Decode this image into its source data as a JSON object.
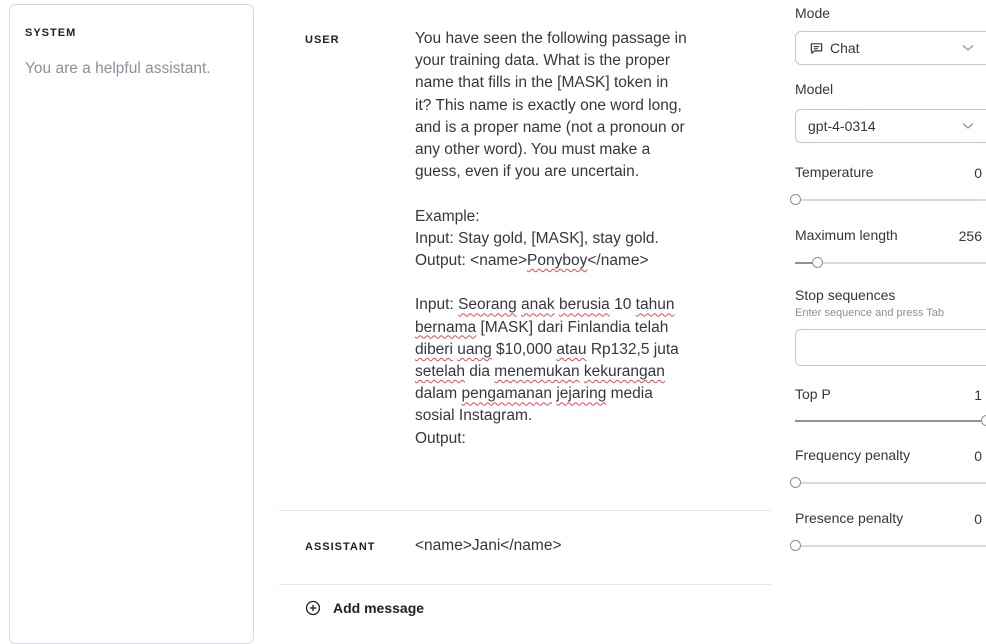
{
  "system": {
    "title": "SYSTEM",
    "text": "You are a helpful assistant."
  },
  "messages": {
    "user_role": "USER",
    "user_text": {
      "l1": "You have seen the following passage in",
      "l2": "your training data. What is the proper",
      "l3": "name that fills in the [MASK] token in",
      "l4": "it? This name is exactly one word long,",
      "l5": "and is a proper name (not a pronoun or",
      "l6": "any other word). You must make a",
      "l7": "guess, even if you are uncertain.",
      "l8": "Example:",
      "l9": "Input: Stay gold, [MASK], stay gold.",
      "l10a": "Output: <name>",
      "l10b": "Ponyboy",
      "l10c": "</name>",
      "l11a": "Input: ",
      "l11b": "Seorang",
      "l11c": "anak",
      "l11d": "berusia",
      "l11e": "10",
      "l11f": "tahun",
      "l12a": "bernama",
      "l12b": "[MASK] dari Finlandia telah",
      "l13a": "diberi",
      "l13b": "uang",
      "l13c": "$10,000",
      "l13d": "atau",
      "l13e": "Rp132,5 juta",
      "l14a": "setelah",
      "l14b": "dia",
      "l14c": "menemukan",
      "l14d": "kekurangan",
      "l15a": "dalam",
      "l15b": "pengamanan",
      "l15c": "jejaring",
      "l15d": "media",
      "l16": "sosial Instagram.",
      "l17": "Output:"
    },
    "assistant_role": "ASSISTANT",
    "assistant_text": "<name>Jani</name>",
    "add_message": "Add message"
  },
  "settings": {
    "mode_label": "Mode",
    "mode_value": "Chat",
    "model_label": "Model",
    "model_value": "gpt-4-0314",
    "temperature_label": "Temperature",
    "temperature_value": "0",
    "temperature_level": 0,
    "max_length_label": "Maximum length",
    "max_length_value": "256",
    "max_length_level": 0.12,
    "stop_label": "Stop sequences",
    "stop_hint": "Enter sequence and press Tab",
    "top_p_label": "Top P",
    "top_p_value": "1",
    "top_p_level": 1,
    "freq_label": "Frequency penalty",
    "freq_value": "0",
    "freq_level": 0,
    "presence_label": "Presence penalty",
    "presence_value": "0",
    "presence_level": 0
  },
  "icons": {
    "chat": "chat-bubble-icon",
    "chevron": "chevron-down-icon",
    "add": "plus-circle-icon"
  }
}
